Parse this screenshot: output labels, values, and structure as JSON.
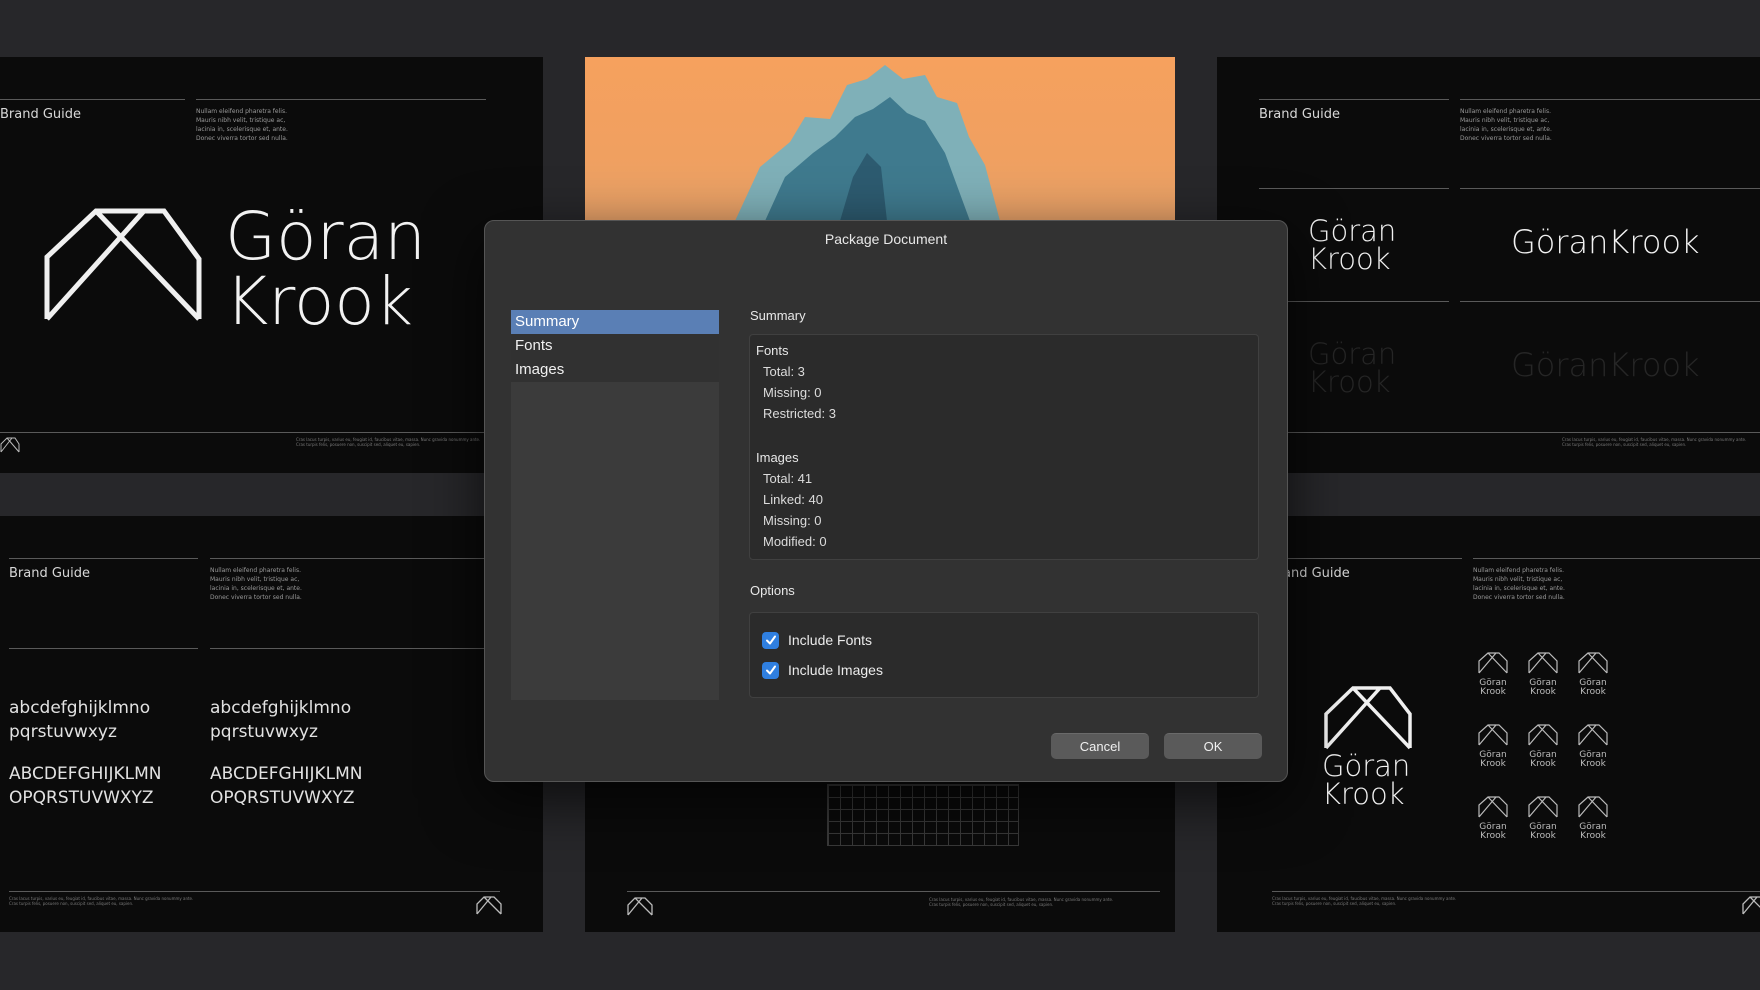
{
  "background": {
    "brand_label": "Brand Guide",
    "brand_label_cropped": "and Guide",
    "lorem_short": "Nullam eleifend pharetra felis. Mauris nibh velit, tristique ac, lacinia in, scelerisque et, ante. Donec viverra tortor sed nulla.",
    "fine_print": "Cras lacus turpis, varius eu, feugiat id, faucibus vitae, massa. Nunc gravida nonummy ante. Cras turpis felis, posuere non, suscipit sed, aliquet eu, sapien.",
    "wordmark_line1": "Göran",
    "wordmark_line2": "Krook",
    "wordmark_joined": "GöranKrook",
    "lowercase_line1": "abcdefghijklmno",
    "lowercase_line2": "pqrstuvwxyz",
    "uppercase_line1": "ABCDEFGHIJKLMN",
    "uppercase_line2": "OPQRSTUVWXYZ",
    "mini_label_line1": "Göran",
    "mini_label_line2": "Krook"
  },
  "dialog": {
    "title": "Package Document",
    "nav": [
      {
        "label": "Summary",
        "selected": true
      },
      {
        "label": "Fonts",
        "selected": false
      },
      {
        "label": "Images",
        "selected": false
      }
    ],
    "summary_heading": "Summary",
    "fonts_heading": "Fonts",
    "fonts_stats": [
      "Total: 3",
      "Missing: 0",
      "Restricted: 3"
    ],
    "images_heading": "Images",
    "images_stats": [
      "Total: 41",
      "Linked: 40",
      "Missing: 0",
      "Modified: 0"
    ],
    "options_heading": "Options",
    "options": [
      {
        "label": "Include Fonts",
        "checked": true
      },
      {
        "label": "Include Images",
        "checked": true
      }
    ],
    "cancel_label": "Cancel",
    "ok_label": "OK"
  },
  "colors": {
    "accent": "#2f7fe0",
    "selection": "#5a7fb5",
    "dialog_bg": "#323232",
    "page_bg": "#27272a",
    "photo_orange": "#f6a15e"
  }
}
